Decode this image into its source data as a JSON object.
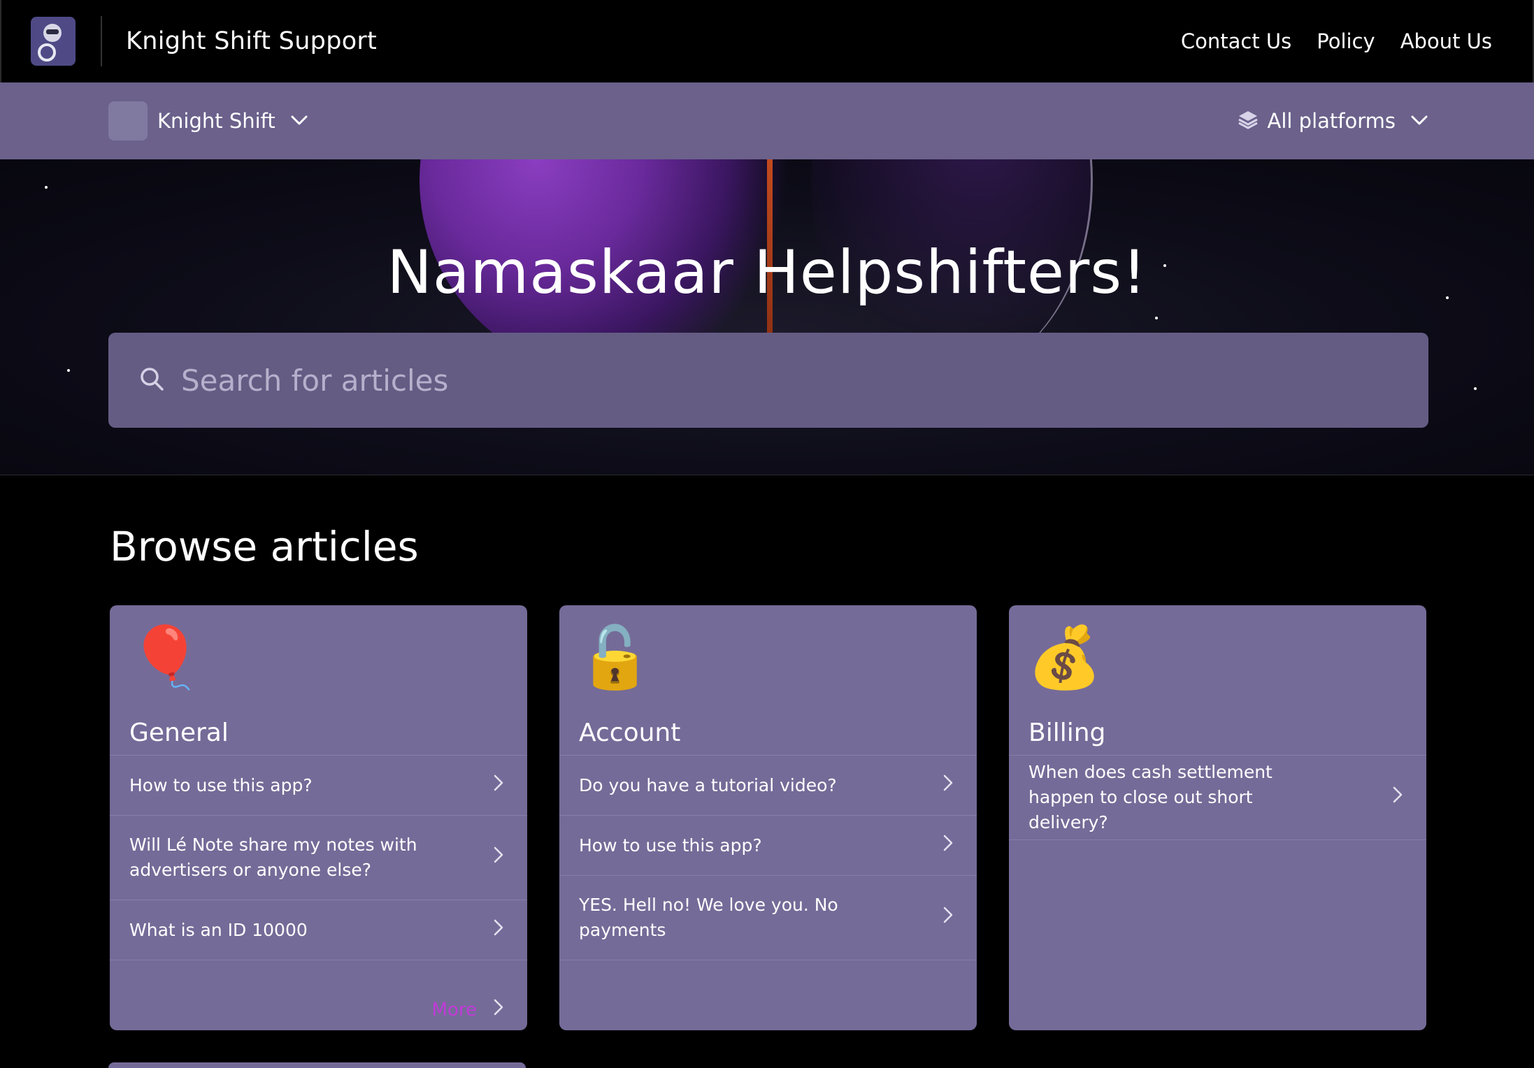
{
  "header": {
    "site_title": "Knight Shift Support",
    "nav": [
      "Contact Us",
      "Policy",
      "About Us"
    ]
  },
  "subbar": {
    "app_name": "Knight Shift",
    "platform_label": "All platforms"
  },
  "hero": {
    "title": "Namaskaar Helpshifters!",
    "search_placeholder": "Search for articles"
  },
  "browse": {
    "heading": "Browse articles",
    "categories": [
      {
        "emoji": "🎈",
        "title": "General",
        "articles": [
          "How to use this app?",
          "Will Lé Note share my notes with advertisers or anyone else?",
          "What is an ID 10000"
        ],
        "more_label": "More"
      },
      {
        "emoji": "🔓",
        "title": "Account",
        "articles": [
          "Do you have a tutorial video?",
          "How to use this app?",
          "YES. Hell no! We love you. No payments"
        ]
      },
      {
        "emoji": "💰",
        "title": "Billing",
        "articles": [
          "When does cash settlement happen to close out short delivery?"
        ]
      }
    ]
  },
  "colors": {
    "subbar_bg": "#6b618b",
    "card_bg": "#756b98",
    "search_bg": "#655c84",
    "more_accent": "#c13ad8"
  },
  "icons": [
    "search-icon",
    "chevron-down-icon",
    "layers-icon",
    "chevron-right-icon"
  ]
}
